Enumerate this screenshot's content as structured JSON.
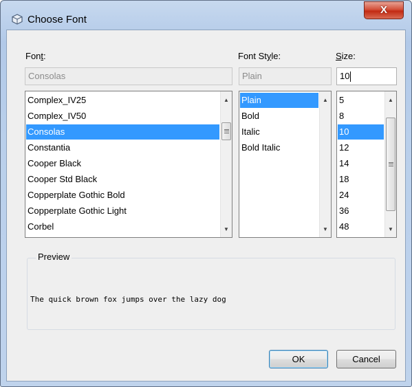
{
  "window": {
    "title": "Choose Font",
    "close_label": "X"
  },
  "font": {
    "label": "Font:",
    "value": "Consolas",
    "items": [
      "Complex_IV25",
      "Complex_IV50",
      "Consolas",
      "Constantia",
      "Cooper Black",
      "Cooper Std Black",
      "Copperplate Gothic Bold",
      "Copperplate Gothic Light",
      "Corbel"
    ],
    "selected": "Consolas"
  },
  "style": {
    "label": "Font Style:",
    "value": "Plain",
    "items": [
      "Plain",
      "Bold",
      "Italic",
      "Bold Italic"
    ],
    "selected": "Plain"
  },
  "size": {
    "label": "Size:",
    "value": "10",
    "items": [
      "5",
      "8",
      "10",
      "12",
      "14",
      "18",
      "24",
      "36",
      "48"
    ],
    "selected": "10"
  },
  "preview": {
    "legend": "Preview",
    "text": "The quick brown fox jumps over the lazy dog"
  },
  "buttons": {
    "ok": "OK",
    "cancel": "Cancel"
  },
  "colors": {
    "selection": "#3399ff",
    "close_button": "#c7402a"
  }
}
